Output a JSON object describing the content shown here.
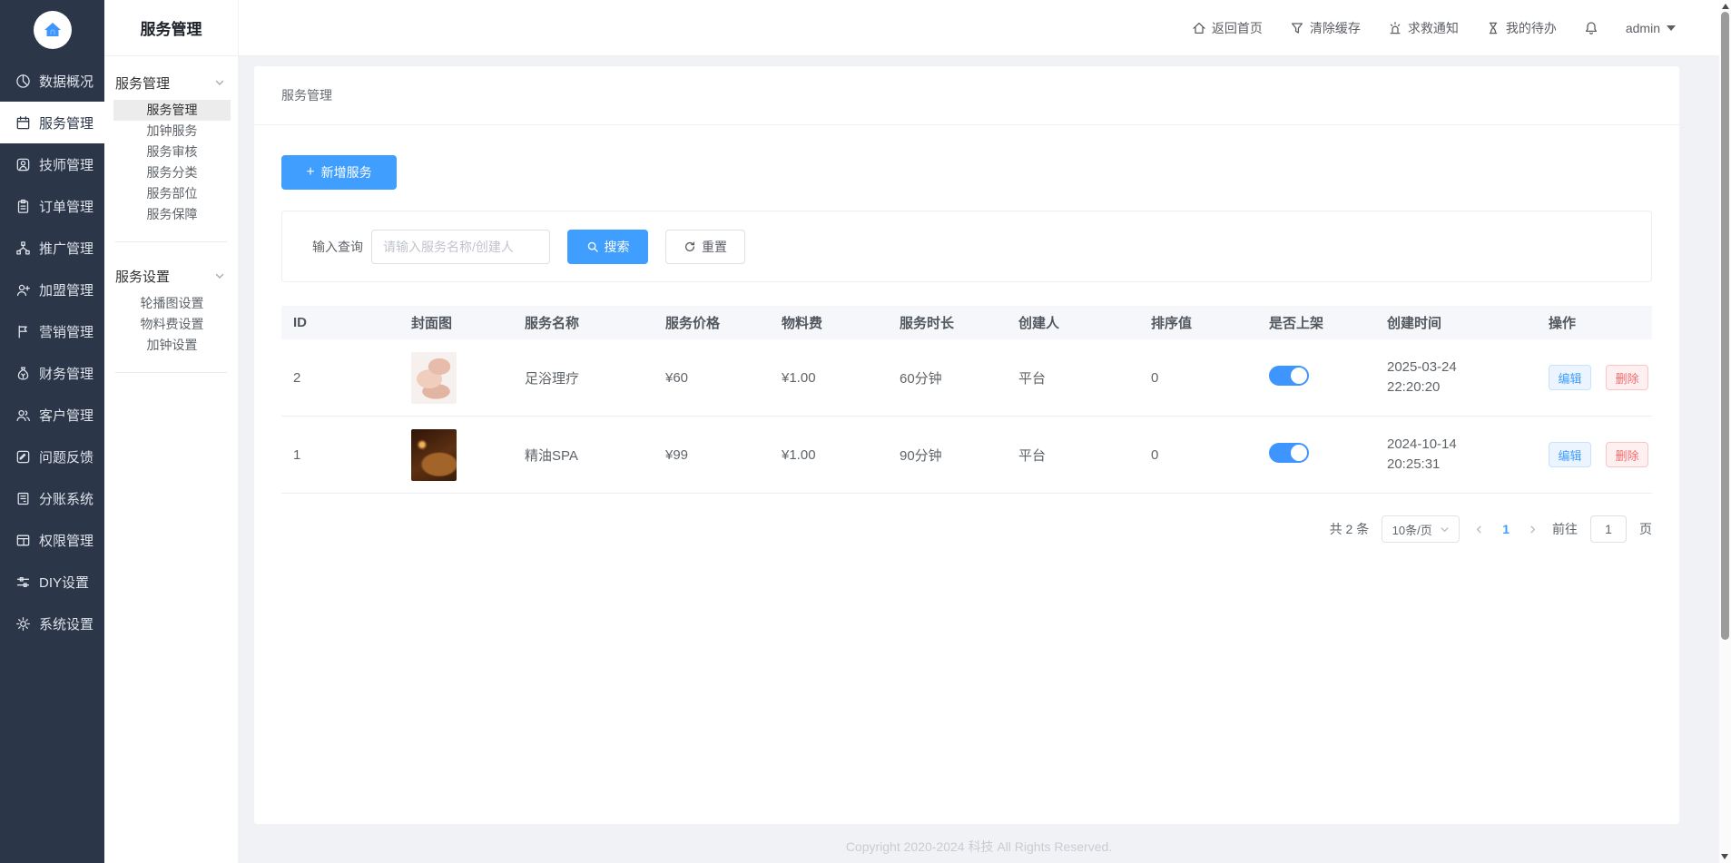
{
  "submenu": {
    "title": "服务管理",
    "groups": [
      {
        "label": "服务管理",
        "items": [
          "服务管理",
          "加钟服务",
          "服务审核",
          "服务分类",
          "服务部位",
          "服务保障"
        ]
      },
      {
        "label": "服务设置",
        "items": [
          "轮播图设置",
          "物料费设置",
          "加钟设置"
        ]
      }
    ]
  },
  "sidebar": {
    "items": [
      "数据概况",
      "服务管理",
      "技师管理",
      "订单管理",
      "推广管理",
      "加盟管理",
      "营销管理",
      "财务管理",
      "客户管理",
      "问题反馈",
      "分账系统",
      "权限管理",
      "DIY设置",
      "系统设置"
    ]
  },
  "topbar": {
    "nav": [
      "返回首页",
      "清除缓存",
      "求救通知",
      "我的待办"
    ],
    "user": "admin"
  },
  "breadcrumb": "服务管理",
  "toolbar": {
    "add_icon": "+",
    "add_label": "新增服务"
  },
  "search": {
    "label": "输入查询",
    "placeholder": "请输入服务名称/创建人",
    "search_label": "搜索",
    "reset_label": "重置"
  },
  "table": {
    "columns": [
      "ID",
      "封面图",
      "服务名称",
      "服务价格",
      "物料费",
      "服务时长",
      "创建人",
      "排序值",
      "是否上架",
      "创建时间",
      "操作"
    ],
    "actions": {
      "edit_label": "编辑",
      "delete_label": "删除"
    },
    "rows": [
      {
        "id": "2",
        "image": "foot-massage-photo",
        "name": "足浴理疗",
        "price": "¥60",
        "material_fee": "¥1.00",
        "duration": "60分钟",
        "creator": "平台",
        "sort": "0",
        "on_shelf": "on",
        "created_date": "2025-03-24",
        "created_time": "22:20:20"
      },
      {
        "id": "1",
        "image": "spa-candle-photo",
        "name": "精油SPA",
        "price": "¥99",
        "material_fee": "¥1.00",
        "duration": "90分钟",
        "creator": "平台",
        "sort": "0",
        "on_shelf": "on",
        "created_date": "2024-10-14",
        "created_time": "20:25:31"
      }
    ]
  },
  "pagination": {
    "total": "共 2 条",
    "page_size": "10条/页",
    "current": "1",
    "goto_label": "前往",
    "goto_value": "1",
    "unit": "页"
  },
  "footer": {
    "copyright": "Copyright 2020-2024 科技 All Rights Reserved."
  },
  "colors": {
    "accent": "#409eff",
    "danger": "#f56c6c",
    "sidebar_bg": "#2b3649",
    "toggle_on": "#3d95fd"
  }
}
